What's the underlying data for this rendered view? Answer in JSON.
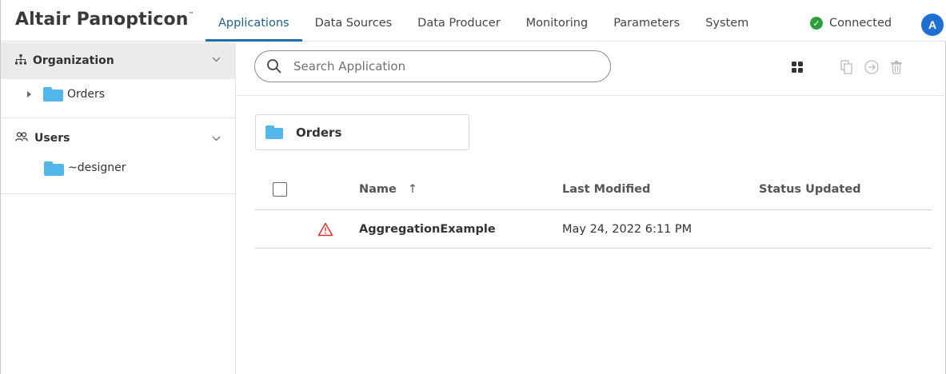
{
  "app": {
    "logo_text": "Altair Panopticon",
    "logo_mark": "™"
  },
  "nav": {
    "tabs": [
      {
        "label": "Applications",
        "active": true
      },
      {
        "label": "Data Sources",
        "active": false
      },
      {
        "label": "Data Producer",
        "active": false
      },
      {
        "label": "Monitoring",
        "active": false
      },
      {
        "label": "Parameters",
        "active": false
      },
      {
        "label": "System",
        "active": false
      }
    ],
    "status_label": "Connected",
    "status_icon": "check-circle-icon",
    "status_color": "#2e9e3a",
    "avatar_initial": "A",
    "avatar_color": "#1f6fd1"
  },
  "sidebar": {
    "organization_label": "Organization",
    "organization_icon": "hierarchy-icon",
    "org_items": [
      {
        "label": "Orders"
      }
    ],
    "users_label": "Users",
    "users_icon": "users-icon",
    "user_items": [
      {
        "label": "~designer"
      }
    ]
  },
  "toolbar": {
    "search_placeholder": "Search Application",
    "icons": [
      "grid-view-icon",
      "copy-icon",
      "move-icon",
      "trash-icon"
    ]
  },
  "breadcrumb": {
    "folder_label": "Orders"
  },
  "table": {
    "columns": {
      "name": "Name",
      "sort_indicator": "↑",
      "last_modified": "Last Modified",
      "status_updated": "Status Updated"
    },
    "rows": [
      {
        "icon": "warning-icon",
        "name": "AggregationExample",
        "last_modified": "May 24, 2022 6:11 PM",
        "status_updated": ""
      }
    ]
  },
  "colors": {
    "accent": "#1f6fae",
    "folder": "#52b6e8",
    "warning": "#d9342b"
  }
}
